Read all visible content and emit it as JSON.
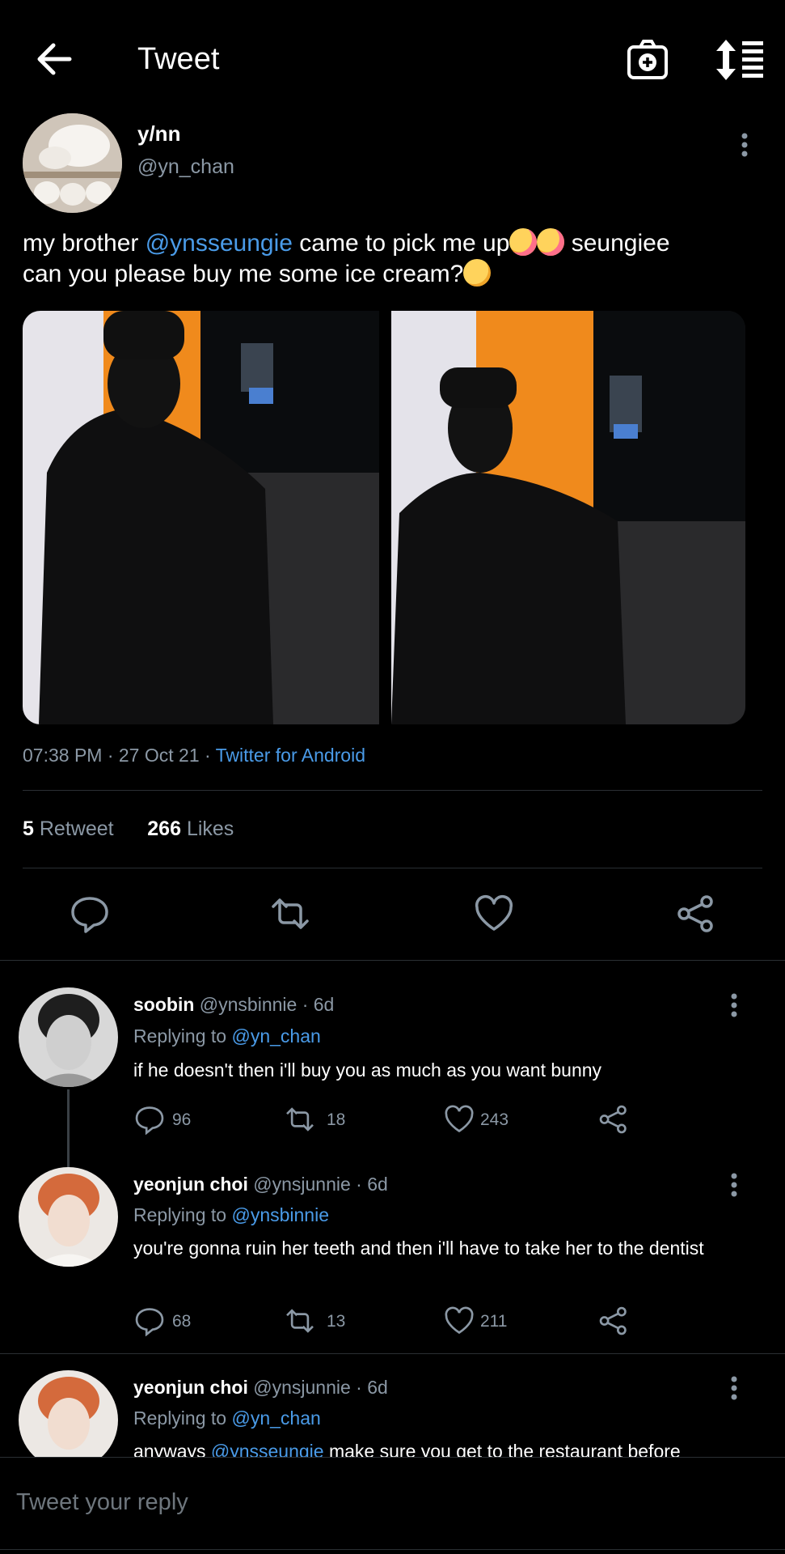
{
  "header": {
    "title": "Tweet",
    "icons": [
      "back-arrow-icon",
      "camera-plus-icon",
      "sort-icon"
    ]
  },
  "tweet": {
    "name": "y/nn",
    "handle": "@yn_chan",
    "text_before": "my brother ",
    "mention": "@ynsseungie",
    "text_middle": " came to pick me up",
    "text_after": " seungiee",
    "text_line2": "can you please buy me some ice cream?",
    "time": "07:38 PM · 27 Oct 21 · ",
    "source": "Twitter for Android",
    "retweets_count": "5",
    "retweets_label": "Retweet",
    "likes_count": "266",
    "likes_label": "Likes"
  },
  "replies": [
    {
      "name": "soobin",
      "handle_time": " @ynsbinnie · 6d",
      "replying_label": "Replying to ",
      "replying_to": "@yn_chan",
      "text": "if he doesn't then i'll buy you as much as you want bunny",
      "replies": "96",
      "retweets": "18",
      "likes": "243"
    },
    {
      "name": "yeonjun choi",
      "handle_time": " @ynsjunnie · 6d",
      "replying_label": "Replying to ",
      "replying_to": "@ynsbinnie",
      "text": "you're gonna ruin her teeth and then i'll have to take her to the dentist",
      "replies": "68",
      "retweets": "13",
      "likes": "211"
    },
    {
      "name": "yeonjun choi",
      "handle_time": " @ynsjunnie · 6d",
      "replying_label": "Replying to ",
      "replying_to": "@yn_chan",
      "text_before": "anyways ",
      "text_mention": "@ynsseungie",
      "text_after": " make sure you get to the restaurant before"
    }
  ],
  "reply_bar": {
    "placeholder": "Tweet your reply"
  },
  "colors": {
    "background": "#000000",
    "link": "#4a9be8",
    "muted": "#8b98a5"
  }
}
